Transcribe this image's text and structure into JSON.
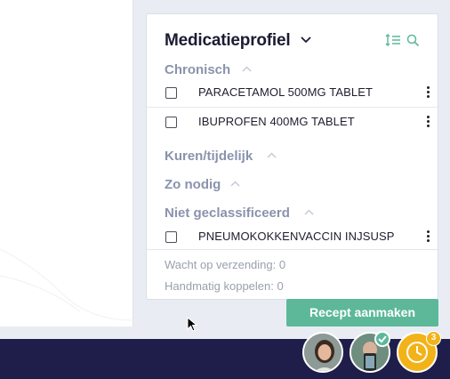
{
  "medication_profile": {
    "title": "Medicatieprofiel",
    "sections": [
      {
        "label": "Chronisch",
        "items": [
          "PARACETAMOL 500MG TABLET",
          "IBUPROFEN 400MG TABLET"
        ]
      },
      {
        "label": "Kuren/tijdelijk",
        "items": []
      },
      {
        "label": "Zo nodig",
        "items": []
      },
      {
        "label": "Niet geclassificeerd",
        "items": [
          "PNEUMOKOKKENVACCIN INJSUSP"
        ]
      }
    ],
    "footer": {
      "awaiting_sending": "Wacht op verzending: 0",
      "manual_link": "Handmatig koppelen: 0"
    }
  },
  "actions": {
    "create_prescription": "Recept aanmaken"
  },
  "taskbar": {
    "notification_count": "3"
  },
  "colors": {
    "accent": "#5cb899",
    "section_header": "#8a93ad",
    "bar": "#1f1e4a",
    "clock": "#f2b319"
  },
  "icons": [
    "chevron-down-icon",
    "sort-icon",
    "search-icon",
    "chevron-up-icon",
    "checkbox-icon",
    "kebab-menu-icon",
    "clock-icon",
    "check-icon"
  ]
}
